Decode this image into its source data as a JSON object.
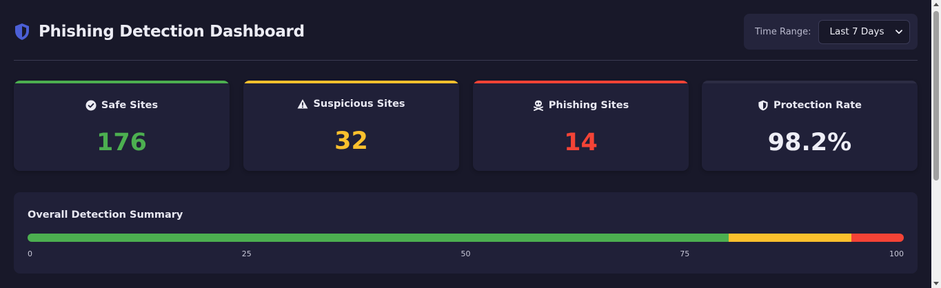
{
  "header": {
    "title": "Phishing Detection Dashboard",
    "icon": "shield-icon",
    "accent": "#4b5fd6"
  },
  "time_range": {
    "label": "Time Range:",
    "selected": "Last 7 Days"
  },
  "stats": [
    {
      "label": "Safe Sites",
      "value": "176",
      "icon": "check-circle-icon",
      "color": "#4caf50"
    },
    {
      "label": "Suspicious Sites",
      "value": "32",
      "icon": "warning-icon",
      "color": "#fbc02d"
    },
    {
      "label": "Phishing Sites",
      "value": "14",
      "icon": "skull-crossbones-icon",
      "color": "#f44336"
    },
    {
      "label": "Protection Rate",
      "value": "98.2%",
      "icon": "shield-half-icon",
      "color": "#eeeef6"
    }
  ],
  "summary": {
    "title": "Overall Detection Summary",
    "segments": [
      {
        "name": "safe",
        "percent": 80.0,
        "color": "#4caf50"
      },
      {
        "name": "suspicious",
        "percent": 14.0,
        "color": "#fbc02d"
      },
      {
        "name": "phishing",
        "percent": 6.0,
        "color": "#f44336"
      }
    ],
    "ticks": [
      "0",
      "25",
      "50",
      "75",
      "100"
    ]
  }
}
